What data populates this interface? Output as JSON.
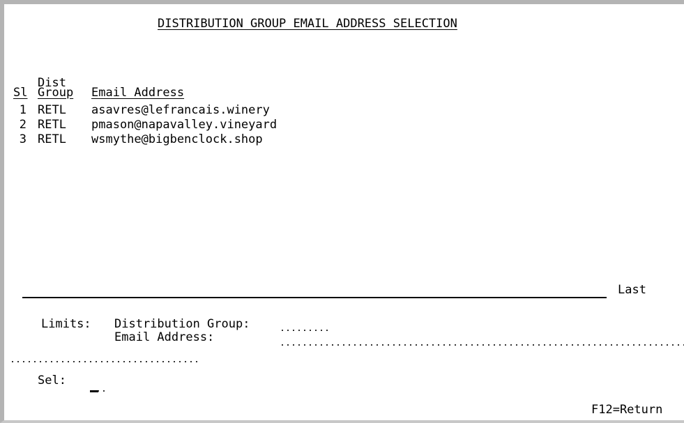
{
  "screen": {
    "title": "DISTRIBUTION GROUP EMAIL ADDRESS SELECTION",
    "columns": {
      "dist_line1": "Dist",
      "sl": "Sl",
      "group": "Group",
      "email": "Email Address"
    },
    "rows": [
      {
        "num": "1",
        "group": "RETL",
        "email": "asavres@lefrancais.winery"
      },
      {
        "num": "2",
        "group": "RETL",
        "email": "pmason@napavalley.vineyard"
      },
      {
        "num": "3",
        "group": "RETL",
        "email": "wsmythe@bigbenclock.shop"
      }
    ],
    "status": "Last",
    "limits": {
      "label": "Limits:",
      "dist_group_label": "Distribution Group:",
      "email_label": "Email Address:"
    },
    "selection": {
      "label": "Sel:"
    },
    "fkeys": {
      "f12": "F12=Return"
    }
  }
}
